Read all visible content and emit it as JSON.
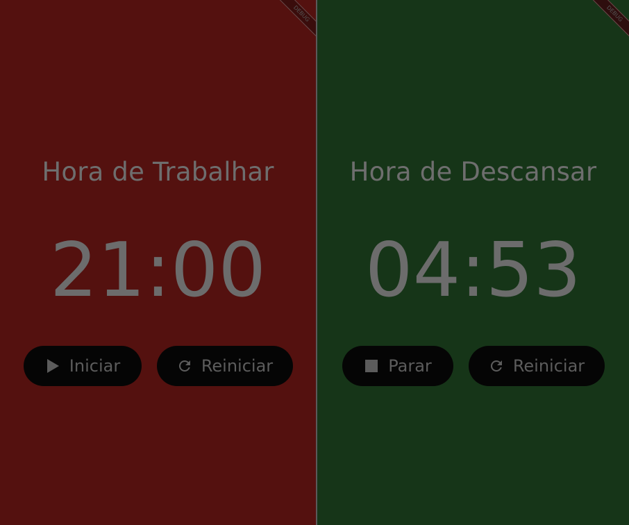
{
  "work": {
    "title": "Hora de Trabalhar",
    "time": "21:00",
    "start_label": "Iniciar",
    "reset_label": "Reiniciar",
    "banner": "DEBUG"
  },
  "rest": {
    "title": "Hora de Descansar",
    "time": "04:53",
    "stop_label": "Parar",
    "reset_label": "Reiniciar",
    "banner": "DEBUG"
  },
  "colors": {
    "work_bg": "#54110f",
    "rest_bg": "#163518",
    "button_bg": "#050505",
    "text": "#6e6e6e"
  },
  "icons": {
    "start": "play-icon",
    "stop": "stop-icon",
    "reset": "refresh-icon"
  }
}
